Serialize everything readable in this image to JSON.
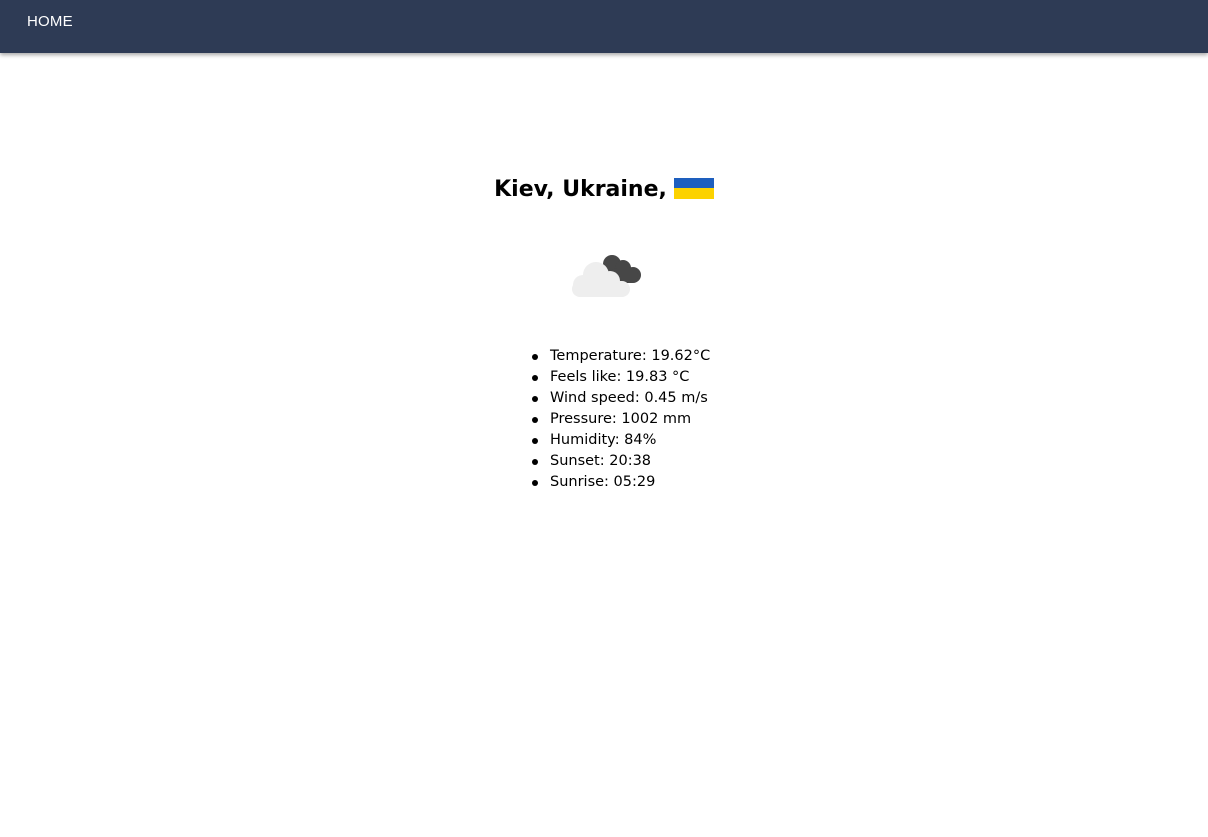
{
  "nav": {
    "home_label": "HOME",
    "background": "#2e3b55"
  },
  "location": {
    "title": "Kiev, Ukraine,",
    "flag_icon": "ukraine-flag-icon",
    "flag_colors": [
      "#1e5fbe",
      "#fcd200"
    ]
  },
  "weather": {
    "icon": "cloudy-icon"
  },
  "details": [
    {
      "text": "Temperature: 19.62°C"
    },
    {
      "text": "Feels like: 19.83 °C"
    },
    {
      "text": "Wind speed: 0.45 m/s"
    },
    {
      "text": "Pressure: 1002 mm"
    },
    {
      "text": "Humidity: 84%"
    },
    {
      "text": "Sunset: 20:38"
    },
    {
      "text": "Sunrise: 05:29"
    }
  ]
}
